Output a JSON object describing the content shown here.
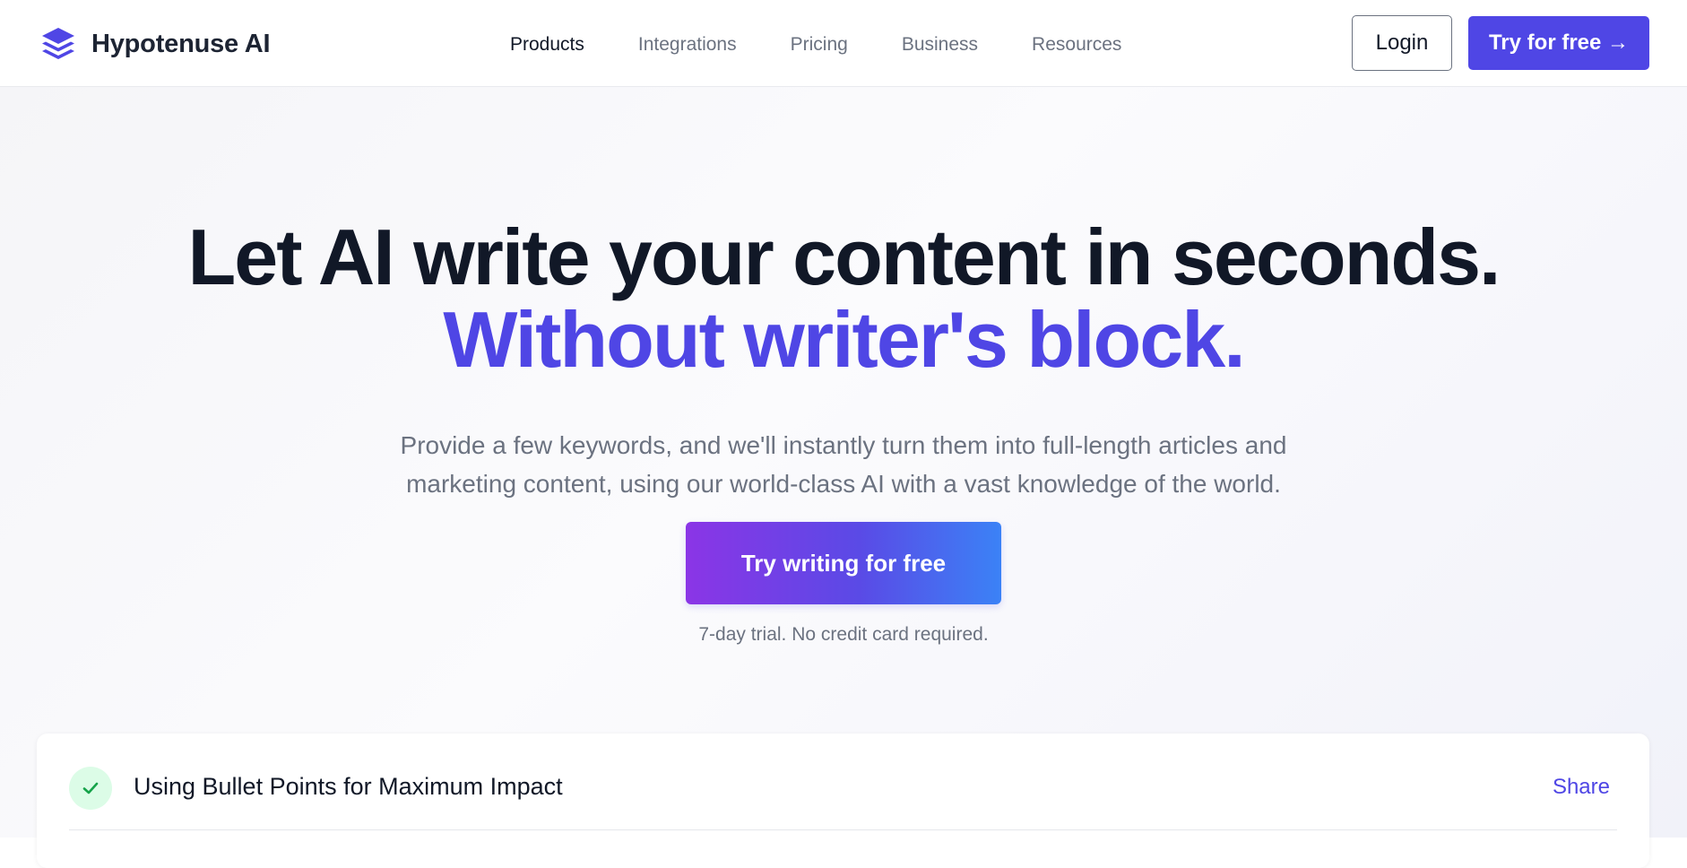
{
  "brand": {
    "name": "Hypotenuse AI",
    "logo_icon": "layers-stack-icon"
  },
  "nav": {
    "items": [
      {
        "label": "Products",
        "active": true
      },
      {
        "label": "Integrations",
        "active": false
      },
      {
        "label": "Pricing",
        "active": false
      },
      {
        "label": "Business",
        "active": false
      },
      {
        "label": "Resources",
        "active": false
      }
    ]
  },
  "header": {
    "login_label": "Login",
    "try_label": "Try for free →"
  },
  "hero": {
    "headline": "Let AI write your content in seconds.",
    "headline_accent": "Without writer's block.",
    "subtitle": "Provide a few keywords, and we'll instantly turn them into full-length articles and marketing content, using our world-class AI with a vast knowledge of the world.",
    "cta_label": "Try writing for free",
    "trial_note": "7-day trial. No credit card required."
  },
  "card": {
    "status_icon": "check-icon",
    "title": "Using Bullet Points for Maximum Impact",
    "share_label": "Share"
  },
  "colors": {
    "accent": "#4f46e5",
    "heading": "#111827",
    "muted": "#6b7280",
    "success_bg": "#dcfce7",
    "success": "#16a34a",
    "cta_gradient_start": "#8b35e6",
    "cta_gradient_end": "#3b82f6"
  }
}
